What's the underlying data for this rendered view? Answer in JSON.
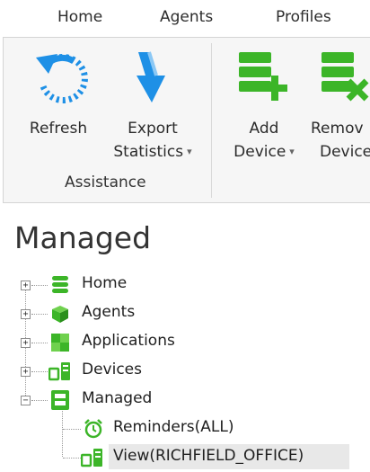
{
  "tabs": [
    "Home",
    "Agents",
    "Profiles"
  ],
  "ribbon": {
    "refresh": "Refresh",
    "export_l1": "Export",
    "export_l2": "Statistics",
    "add_l1": "Add",
    "add_l2": "Device",
    "remove_l1": "Remov",
    "remove_l2": "Device",
    "group_label": "Assistance",
    "dropdown_caret": "▾"
  },
  "page_title": "Managed",
  "tree": {
    "expand_sign": "+",
    "collapse_sign": "−",
    "items": [
      {
        "label": "Home",
        "icon": "database-icon"
      },
      {
        "label": "Agents",
        "icon": "cube-icon"
      },
      {
        "label": "Applications",
        "icon": "puzzle-icon"
      },
      {
        "label": "Devices",
        "icon": "devices-icon"
      },
      {
        "label": "Managed",
        "icon": "managed-icon"
      }
    ],
    "children": [
      {
        "label": "Reminders(ALL)",
        "icon": "alarm-clock-icon"
      },
      {
        "label": "View(RICHFIELD_OFFICE)",
        "icon": "devices-icon"
      }
    ]
  },
  "colors": {
    "accent_blue": "#1e90e6",
    "accent_green": "#3cb528"
  }
}
